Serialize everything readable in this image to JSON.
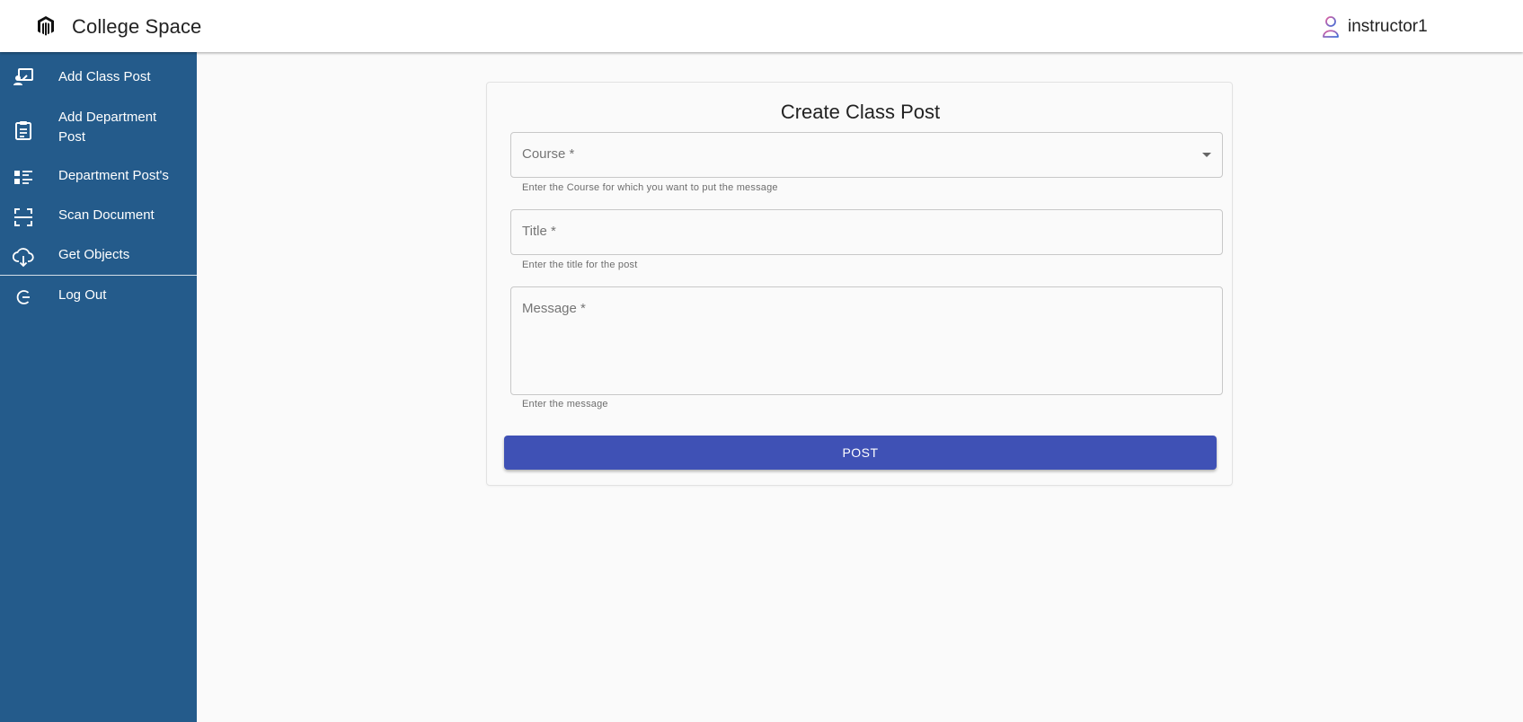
{
  "header": {
    "app_title": "College Space",
    "logo_icon": "magento-logo-icon",
    "user": {
      "icon": "user-icon",
      "name": "instructor1"
    }
  },
  "sidebar": {
    "background_color": "#245b8b",
    "items": [
      {
        "label": "Add Class Post",
        "icon": "class-post-icon"
      },
      {
        "label": "Add Department Post",
        "icon": "clipboard-icon"
      },
      {
        "label": "Department Post's",
        "icon": "list-icon"
      },
      {
        "label": "Scan Document",
        "icon": "scan-icon"
      },
      {
        "label": "Get Objects",
        "icon": "cloud-download-icon"
      },
      {
        "label": "Log Out",
        "icon": "logout-icon"
      }
    ]
  },
  "form": {
    "title": "Create Class Post",
    "course": {
      "label": "Course *",
      "helper": "Enter the Course for which you want to put the message",
      "value": ""
    },
    "title_field": {
      "label": "Title *",
      "helper": "Enter the title for the post",
      "value": ""
    },
    "message": {
      "label": "Message *",
      "helper": "Enter the message",
      "value": ""
    },
    "submit_label": "POST",
    "submit_color": "#3f51b5"
  }
}
